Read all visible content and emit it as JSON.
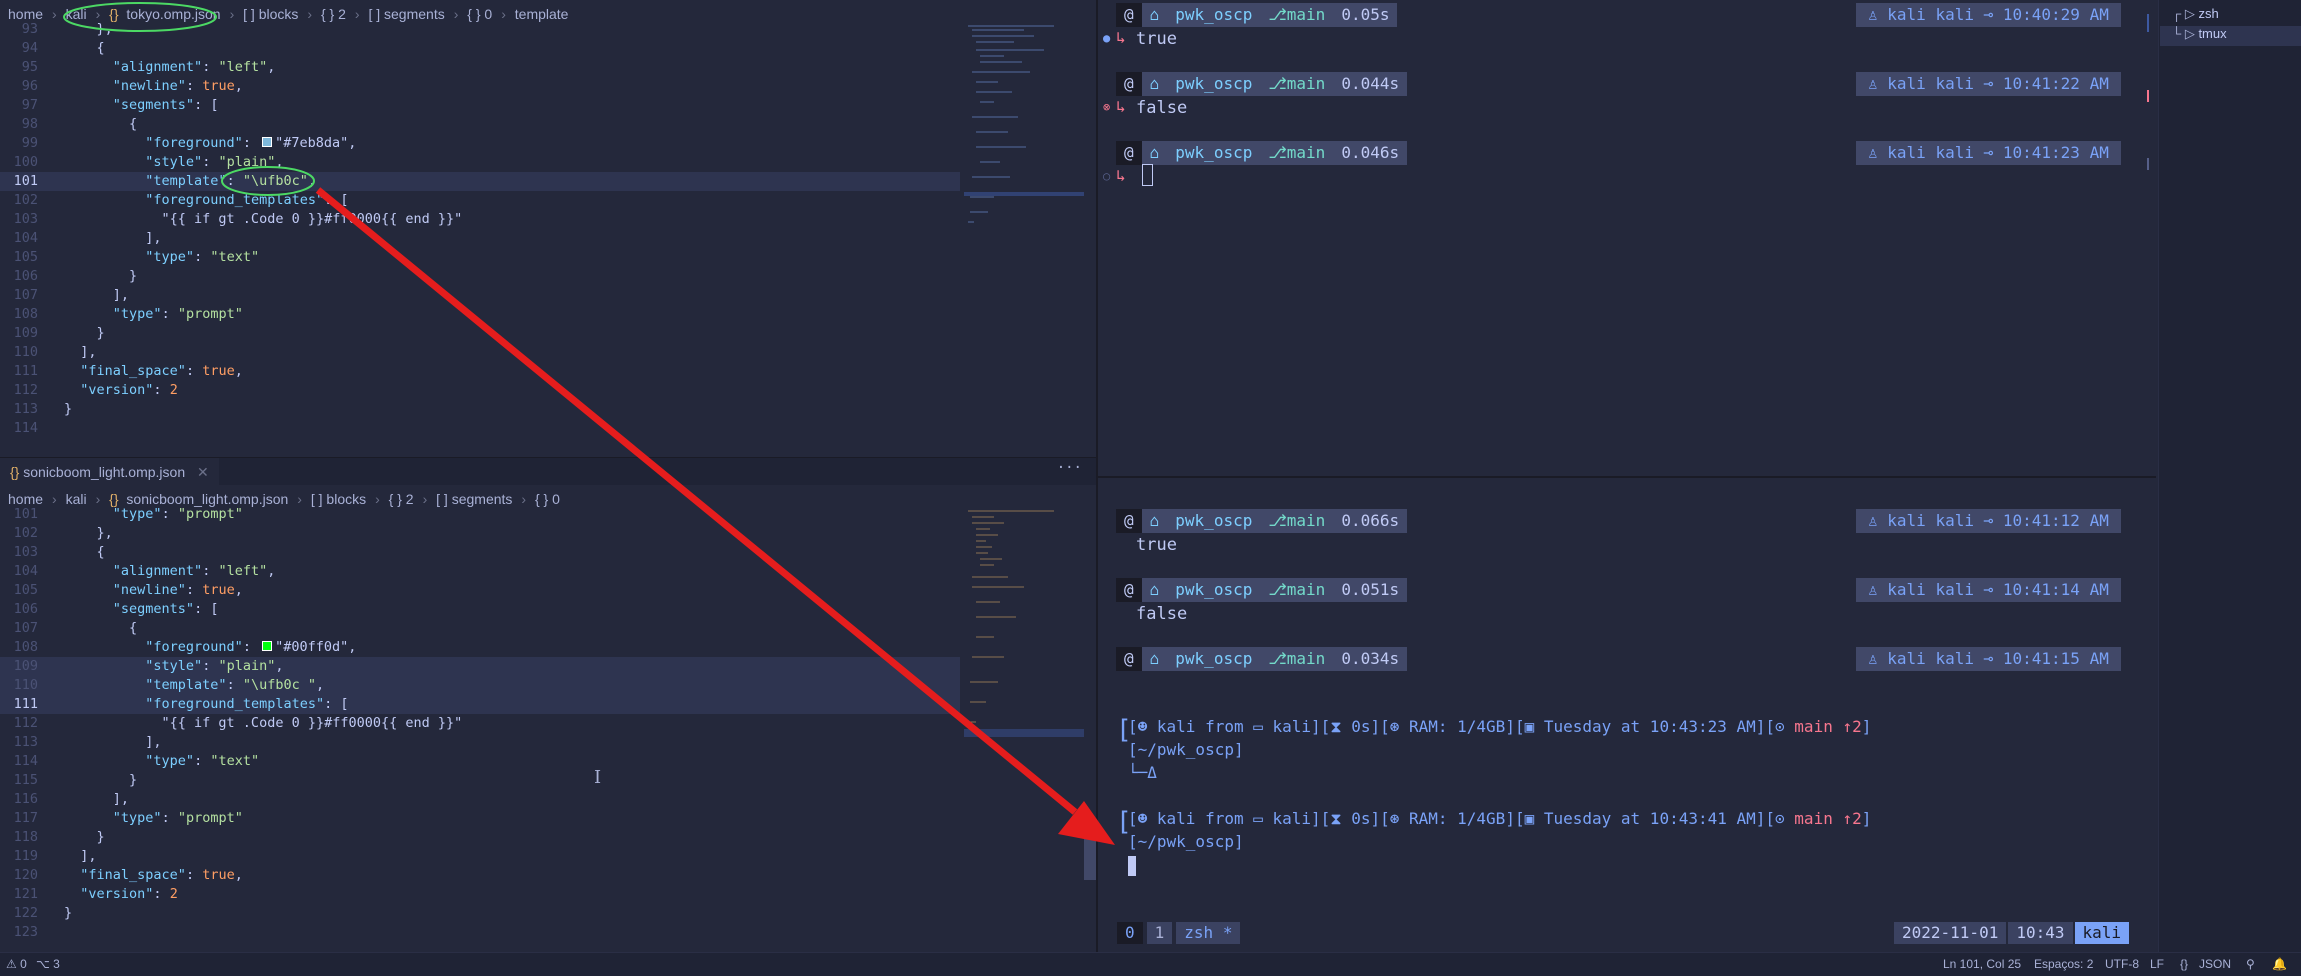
{
  "editor_top": {
    "breadcrumbs": [
      "home",
      "kali",
      "tokyo.omp.json",
      "[ ] blocks",
      "{ } 2",
      "[ ] segments",
      "{ } 0",
      "template"
    ],
    "lines": [
      {
        "n": "93",
        "t": "    },",
        "cls": ""
      },
      {
        "n": "94",
        "t": "    {",
        "cls": ""
      },
      {
        "n": "95",
        "t": "      \"alignment\": \"left\",",
        "cls": ""
      },
      {
        "n": "96",
        "t": "      \"newline\": true,",
        "cls": ""
      },
      {
        "n": "97",
        "t": "      \"segments\": [",
        "cls": ""
      },
      {
        "n": "98",
        "t": "        {",
        "cls": ""
      },
      {
        "n": "99",
        "t": "          \"foreground\": ■\"#7eb8da\",",
        "cls": ""
      },
      {
        "n": "100",
        "t": "          \"style\": \"plain\",",
        "cls": ""
      },
      {
        "n": "101",
        "t": "          \"template\": \"\\ufb0c\",",
        "cls": "act"
      },
      {
        "n": "102",
        "t": "          \"foreground_templates\": [",
        "cls": ""
      },
      {
        "n": "103",
        "t": "            \"{{ if gt .Code 0 }}#ff0000{{ end }}\"",
        "cls": ""
      },
      {
        "n": "104",
        "t": "          ],",
        "cls": ""
      },
      {
        "n": "105",
        "t": "          \"type\": \"text\"",
        "cls": ""
      },
      {
        "n": "106",
        "t": "        }",
        "cls": ""
      },
      {
        "n": "107",
        "t": "      ],",
        "cls": ""
      },
      {
        "n": "108",
        "t": "      \"type\": \"prompt\"",
        "cls": ""
      },
      {
        "n": "109",
        "t": "    }",
        "cls": ""
      },
      {
        "n": "110",
        "t": "  ],",
        "cls": ""
      },
      {
        "n": "111",
        "t": "  \"final_space\": true,",
        "cls": ""
      },
      {
        "n": "112",
        "t": "  \"version\": 2",
        "cls": ""
      },
      {
        "n": "113",
        "t": "}",
        "cls": ""
      },
      {
        "n": "114",
        "t": "",
        "cls": ""
      }
    ]
  },
  "editor_bottom": {
    "tab_label": "sonicboom_light.omp.json",
    "breadcrumbs": [
      "home",
      "kali",
      "sonicboom_light.omp.json",
      "[ ] blocks",
      "{ } 2",
      "[ ] segments",
      "{ } 0"
    ],
    "lines": [
      {
        "n": "101",
        "t": "      \"type\": \"prompt\"",
        "cls": ""
      },
      {
        "n": "102",
        "t": "    },",
        "cls": ""
      },
      {
        "n": "103",
        "t": "    {",
        "cls": ""
      },
      {
        "n": "104",
        "t": "      \"alignment\": \"left\",",
        "cls": ""
      },
      {
        "n": "105",
        "t": "      \"newline\": true,",
        "cls": ""
      },
      {
        "n": "106",
        "t": "      \"segments\": [",
        "cls": ""
      },
      {
        "n": "107",
        "t": "        {",
        "cls": ""
      },
      {
        "n": "108",
        "t": "          \"foreground\": ■\"#00ff0d\",",
        "cls": ""
      },
      {
        "n": "109",
        "t": "          \"style\": \"plain\",",
        "cls": "sel"
      },
      {
        "n": "110",
        "t": "          \"template\": \"\\ufb0c \",",
        "cls": "sel"
      },
      {
        "n": "111",
        "t": "          \"foreground_templates\": [",
        "cls": "act"
      },
      {
        "n": "112",
        "t": "            \"{{ if gt .Code 0 }}#ff0000{{ end }}\"",
        "cls": ""
      },
      {
        "n": "113",
        "t": "          ],",
        "cls": ""
      },
      {
        "n": "114",
        "t": "          \"type\": \"text\"",
        "cls": ""
      },
      {
        "n": "115",
        "t": "        }",
        "cls": ""
      },
      {
        "n": "116",
        "t": "      ],",
        "cls": ""
      },
      {
        "n": "117",
        "t": "      \"type\": \"prompt\"",
        "cls": ""
      },
      {
        "n": "118",
        "t": "    }",
        "cls": ""
      },
      {
        "n": "119",
        "t": "  ],",
        "cls": ""
      },
      {
        "n": "120",
        "t": "  \"final_space\": true,",
        "cls": ""
      },
      {
        "n": "121",
        "t": "  \"version\": 2",
        "cls": ""
      },
      {
        "n": "122",
        "t": "}",
        "cls": ""
      },
      {
        "n": "123",
        "t": "",
        "cls": ""
      }
    ]
  },
  "terminal_top": {
    "prompts": [
      {
        "dir": "pwk_oscp",
        "branch": "main",
        "duration": "0.05s",
        "user": "kali",
        "host": "kali",
        "time": "10:40:29 AM",
        "output": "true"
      },
      {
        "dir": "pwk_oscp",
        "branch": "main",
        "duration": "0.044s",
        "user": "kali",
        "host": "kali",
        "time": "10:41:22 AM",
        "output": "false"
      },
      {
        "dir": "pwk_oscp",
        "branch": "main",
        "duration": "0.046s",
        "user": "kali",
        "host": "kali",
        "time": "10:41:23 AM",
        "output": ""
      }
    ]
  },
  "terminal_bottom": {
    "prompts": [
      {
        "dir": "pwk_oscp",
        "branch": "main",
        "duration": "0.066s",
        "user": "kali",
        "host": "kali",
        "time": "10:41:12 AM",
        "output": "true"
      },
      {
        "dir": "pwk_oscp",
        "branch": "main",
        "duration": "0.051s",
        "user": "kali",
        "host": "kali",
        "time": "10:41:14 AM",
        "output": "false"
      },
      {
        "dir": "pwk_oscp",
        "branch": "main",
        "duration": "0.034s",
        "user": "kali",
        "host": "kali",
        "time": "10:41:15 AM",
        "output": ""
      }
    ],
    "sonic_prompts": [
      {
        "user": "kali",
        "from": "from",
        "host": "kali",
        "elapsed": "0s",
        "ram": "RAM: 1/4GB",
        "date": "Tuesday at 10:43:23 AM",
        "git": "main ↑2",
        "path": "[~/pwk_oscp]",
        "tail": "└─Δ"
      },
      {
        "user": "kali",
        "from": "from",
        "host": "kali",
        "elapsed": "0s",
        "ram": "RAM: 1/4GB",
        "date": "Tuesday at 10:43:41 AM",
        "git": "main ↑2",
        "path": "[~/pwk_oscp]",
        "tail": ""
      }
    ]
  },
  "tmux_bar": {
    "windows": [
      "0",
      "1",
      "zsh *"
    ],
    "date": "2022-11-01",
    "time": "10:43",
    "host": "kali"
  },
  "side_tree": {
    "items": [
      "zsh",
      "tmux"
    ]
  },
  "status_bar": {
    "errors": "0",
    "ports": "3",
    "position": "Ln 101, Col 25",
    "spaces": "Espaços: 2",
    "encoding": "UTF-8",
    "eol": "LF",
    "language": "JSON"
  },
  "colors": {
    "accent_arrow": "#e51d1d",
    "annotation_circle": "#4cd964",
    "swatch_blue": "#7eb8da",
    "swatch_green": "#00ff0d"
  }
}
